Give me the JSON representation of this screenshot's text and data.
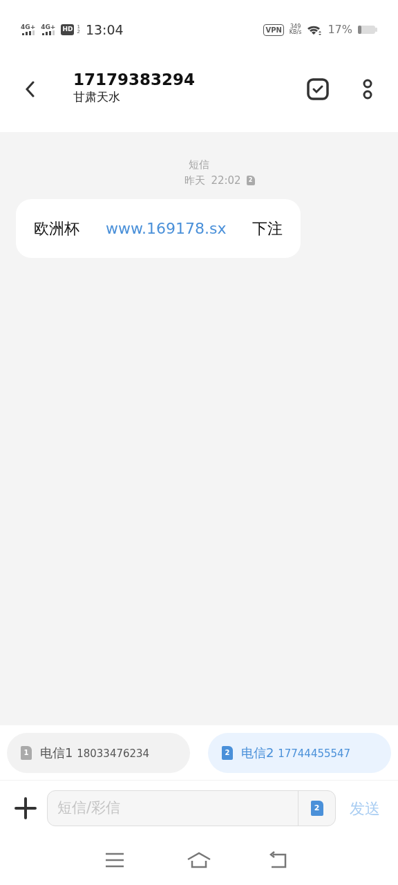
{
  "status_bar": {
    "networks": [
      "4G+",
      "4G+"
    ],
    "hd": "HD",
    "hd_slots": [
      "1",
      "2"
    ],
    "time": "13:04",
    "vpn": "VPN",
    "speed_value": "349",
    "speed_unit": "KB/s",
    "battery": "17%"
  },
  "header": {
    "number": "17179383294",
    "location": "甘肃天水"
  },
  "thread": {
    "type_label": "短信",
    "date": "昨天",
    "time": "22:02",
    "sim": "2"
  },
  "messages": [
    {
      "text_before": "欧洲杯",
      "link": "www.169178.sx",
      "text_after": "下注"
    }
  ],
  "sim_choices": [
    {
      "sim": "1",
      "carrier": "电信1",
      "number": "18033476234",
      "selected": false
    },
    {
      "sim": "2",
      "carrier": "电信2",
      "number": "17744455547",
      "selected": true
    }
  ],
  "composer": {
    "placeholder": "短信/彩信",
    "sim": "2",
    "send": "发送"
  }
}
